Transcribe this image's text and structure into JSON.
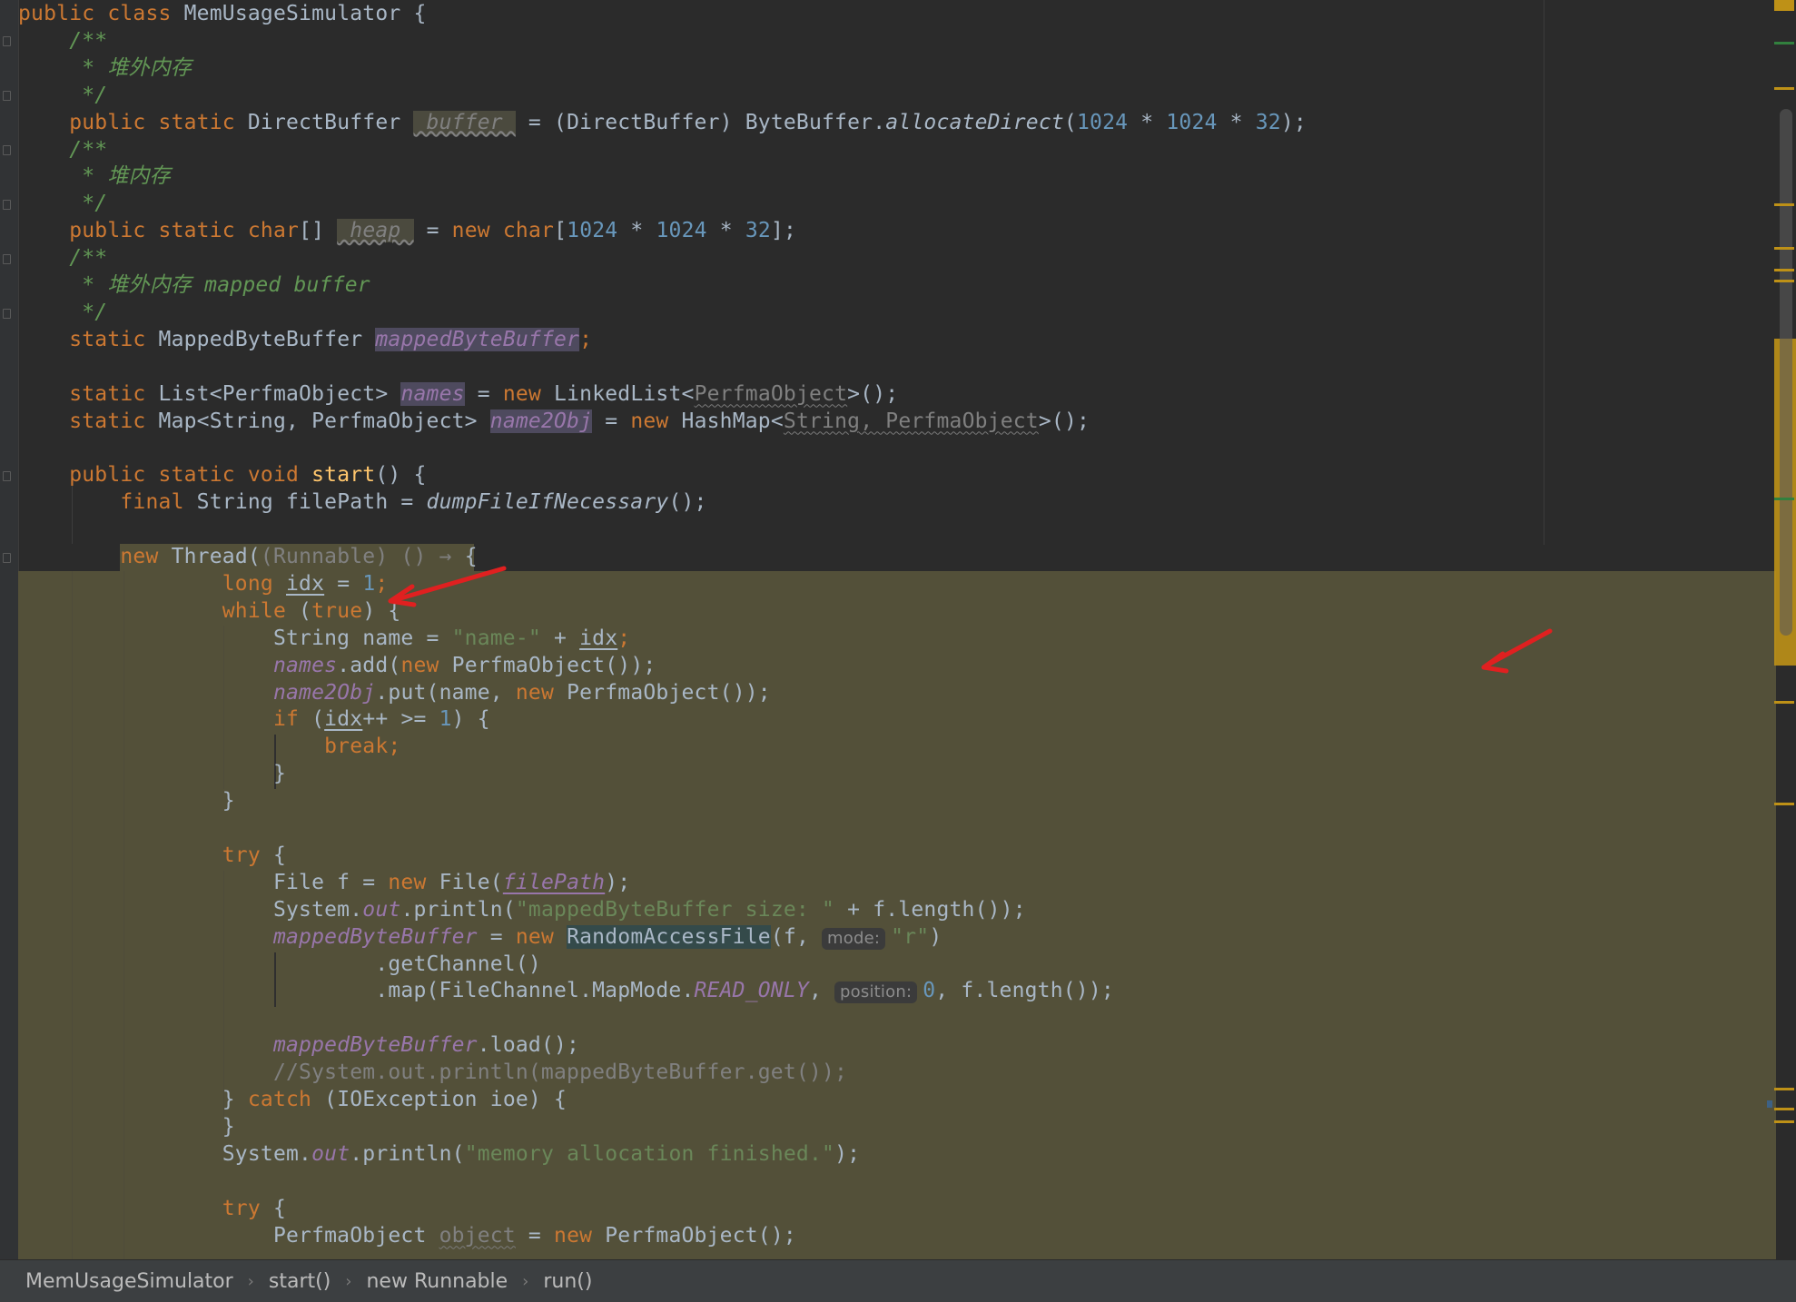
{
  "editor": {
    "code_lines": [
      [
        [
          "public class ",
          "kw"
        ],
        [
          "MemUsageSimulator {",
          ""
        ]
      ],
      [
        [
          "    /**",
          "cm"
        ]
      ],
      [
        [
          "     * 堆外内存",
          "cm"
        ]
      ],
      [
        [
          "     */",
          "cm"
        ]
      ],
      [
        [
          "    public static ",
          "kw"
        ],
        [
          "DirectBuffer ",
          ""
        ],
        [
          " buffer ",
          "unused"
        ],
        [
          " = (DirectBuffer) ByteBuffer.",
          ""
        ],
        [
          "allocateDirect",
          "sm"
        ],
        [
          "(",
          ""
        ],
        [
          "1024",
          "num"
        ],
        [
          " * ",
          ""
        ],
        [
          "1024",
          "num"
        ],
        [
          " * ",
          ""
        ],
        [
          "32",
          "num"
        ],
        [
          ");",
          ""
        ]
      ],
      [
        [
          "    /**",
          "cm"
        ]
      ],
      [
        [
          "     * 堆内存",
          "cm"
        ]
      ],
      [
        [
          "     */",
          "cm"
        ]
      ],
      [
        [
          "    public static ",
          "kw"
        ],
        [
          "char",
          "kw"
        ],
        [
          "[] ",
          ""
        ],
        [
          " heap ",
          "unused"
        ],
        [
          " = ",
          ""
        ],
        [
          "new ",
          "kw"
        ],
        [
          "char",
          "kw"
        ],
        [
          "[",
          ""
        ],
        [
          "1024",
          "num"
        ],
        [
          " * ",
          ""
        ],
        [
          "1024",
          "num"
        ],
        [
          " * ",
          ""
        ],
        [
          "32",
          "num"
        ],
        [
          "];",
          ""
        ]
      ],
      [
        [
          "    /**",
          "cm"
        ]
      ],
      [
        [
          "     * 堆外内存 mapped buffer",
          "cm"
        ]
      ],
      [
        [
          "     */",
          "cm"
        ]
      ],
      [
        [
          "    static ",
          "kw"
        ],
        [
          "MappedByteBuffer ",
          ""
        ],
        [
          "mappedByteBuffer",
          "fld-hl"
        ],
        [
          ";",
          "kw"
        ]
      ],
      [
        [
          "",
          ""
        ]
      ],
      [
        [
          "    static ",
          "kw"
        ],
        [
          "List<PerfmaObject> ",
          ""
        ],
        [
          "names",
          "fld-hl"
        ],
        [
          " = ",
          ""
        ],
        [
          "new ",
          "kw"
        ],
        [
          "LinkedList<",
          ""
        ],
        [
          "PerfmaObject",
          "gray wavy"
        ],
        [
          ">();",
          ""
        ]
      ],
      [
        [
          "    static ",
          "kw"
        ],
        [
          "Map<String, PerfmaObject> ",
          ""
        ],
        [
          "name2Obj",
          "fld-hl"
        ],
        [
          " = ",
          ""
        ],
        [
          "new ",
          "kw"
        ],
        [
          "HashMap<",
          ""
        ],
        [
          "String, PerfmaObject",
          "gray wavy"
        ],
        [
          ">();",
          ""
        ]
      ],
      [
        [
          "",
          ""
        ]
      ],
      [
        [
          "    public static void ",
          "kw"
        ],
        [
          "start",
          "mth"
        ],
        [
          "() {",
          ""
        ]
      ],
      [
        [
          "        final ",
          "kw"
        ],
        [
          "String filePath = ",
          ""
        ],
        [
          "dumpFileIfNecessary",
          "sm"
        ],
        [
          "();",
          ""
        ]
      ],
      [
        [
          "",
          ""
        ]
      ],
      [
        [
          "        new ",
          "kw"
        ],
        [
          "Thread(",
          ""
        ],
        [
          "(Runnable) () → ",
          "gray"
        ],
        [
          "{",
          ""
        ]
      ],
      [
        [
          "                long ",
          "kw"
        ],
        [
          "idx",
          "ul"
        ],
        [
          " = ",
          ""
        ],
        [
          "1",
          "num"
        ],
        [
          ";",
          "kw"
        ]
      ],
      [
        [
          "                while ",
          "kw"
        ],
        [
          "(",
          ""
        ],
        [
          "true",
          "kw"
        ],
        [
          ") {",
          ""
        ]
      ],
      [
        [
          "                    String name = ",
          ""
        ],
        [
          "\"name-\"",
          "str"
        ],
        [
          " + ",
          ""
        ],
        [
          "idx",
          "ul"
        ],
        [
          ";",
          "kw"
        ]
      ],
      [
        [
          "                    ",
          ""
        ],
        [
          "names",
          "fld"
        ],
        [
          ".add(",
          ""
        ],
        [
          "new ",
          "kw"
        ],
        [
          "PerfmaObject());",
          ""
        ]
      ],
      [
        [
          "                    ",
          ""
        ],
        [
          "name2Obj",
          "fld"
        ],
        [
          ".put(name, ",
          ""
        ],
        [
          "new ",
          "kw"
        ],
        [
          "PerfmaObject());",
          ""
        ]
      ],
      [
        [
          "                    if ",
          "kw"
        ],
        [
          "(",
          ""
        ],
        [
          "idx",
          "ul"
        ],
        [
          "++ >= ",
          ""
        ],
        [
          "1",
          "num"
        ],
        [
          ") {",
          ""
        ]
      ],
      [
        [
          "                        break;",
          "kw"
        ]
      ],
      [
        [
          "                    }",
          ""
        ]
      ],
      [
        [
          "                }",
          ""
        ]
      ],
      [
        [
          "",
          ""
        ]
      ],
      [
        [
          "                try ",
          "kw"
        ],
        [
          "{",
          ""
        ]
      ],
      [
        [
          "                    File f = ",
          ""
        ],
        [
          "new ",
          "kw"
        ],
        [
          "File(",
          ""
        ],
        [
          "filePath",
          "fld ul"
        ],
        [
          ");",
          ""
        ]
      ],
      [
        [
          "                    System.",
          ""
        ],
        [
          "out",
          "fld"
        ],
        [
          ".println(",
          ""
        ],
        [
          "\"mappedByteBuffer size: \"",
          "str"
        ],
        [
          " + f.length());",
          ""
        ]
      ],
      [
        [
          "                    ",
          ""
        ],
        [
          "mappedByteBuffer",
          "fld"
        ],
        [
          " = ",
          ""
        ],
        [
          "new ",
          "kw"
        ],
        [
          "RandomAccessFile",
          "raf"
        ],
        [
          "(f, ",
          ""
        ],
        [
          "mode:",
          "hint"
        ],
        [
          "\"r\"",
          "str"
        ],
        [
          ")",
          ""
        ]
      ],
      [
        [
          "                            .getChannel()",
          ""
        ]
      ],
      [
        [
          "                            .map(FileChannel.MapMode.",
          ""
        ],
        [
          "READ_ONLY",
          "fld"
        ],
        [
          ", ",
          ""
        ],
        [
          "position:",
          "hint"
        ],
        [
          "0",
          "num"
        ],
        [
          ", f.length());",
          ""
        ]
      ],
      [
        [
          "",
          ""
        ]
      ],
      [
        [
          "                    ",
          ""
        ],
        [
          "mappedByteBuffer",
          "fld"
        ],
        [
          ".load();",
          ""
        ]
      ],
      [
        [
          "                    //System.out.println(mappedByteBuffer.get());",
          "lcm"
        ]
      ],
      [
        [
          "                } ",
          ""
        ],
        [
          "catch ",
          "kw"
        ],
        [
          "(IOException ioe) {",
          ""
        ]
      ],
      [
        [
          "                }",
          ""
        ]
      ],
      [
        [
          "                System.",
          ""
        ],
        [
          "out",
          "fld"
        ],
        [
          ".println(",
          ""
        ],
        [
          "\"memory allocation finished.\"",
          "str"
        ],
        [
          ");",
          ""
        ]
      ],
      [
        [
          "",
          ""
        ]
      ],
      [
        [
          "                try ",
          "kw"
        ],
        [
          "{",
          ""
        ]
      ],
      [
        [
          "                    PerfmaObject ",
          ""
        ],
        [
          "object",
          "gray wavy"
        ],
        [
          " = ",
          ""
        ],
        [
          "new ",
          "kw"
        ],
        [
          "PerfmaObject();",
          ""
        ]
      ]
    ]
  },
  "breadcrumb": {
    "items": [
      "MemUsageSimulator",
      "start()",
      "new Runnable",
      "run()"
    ],
    "separator": "›"
  },
  "colors": {
    "background": "#2b2b2b",
    "keyword": "#cc7832",
    "number": "#6897bb",
    "string": "#6a8759",
    "field": "#9876aa",
    "highlight": "#535039",
    "annotation_arrow": "#e02020"
  }
}
